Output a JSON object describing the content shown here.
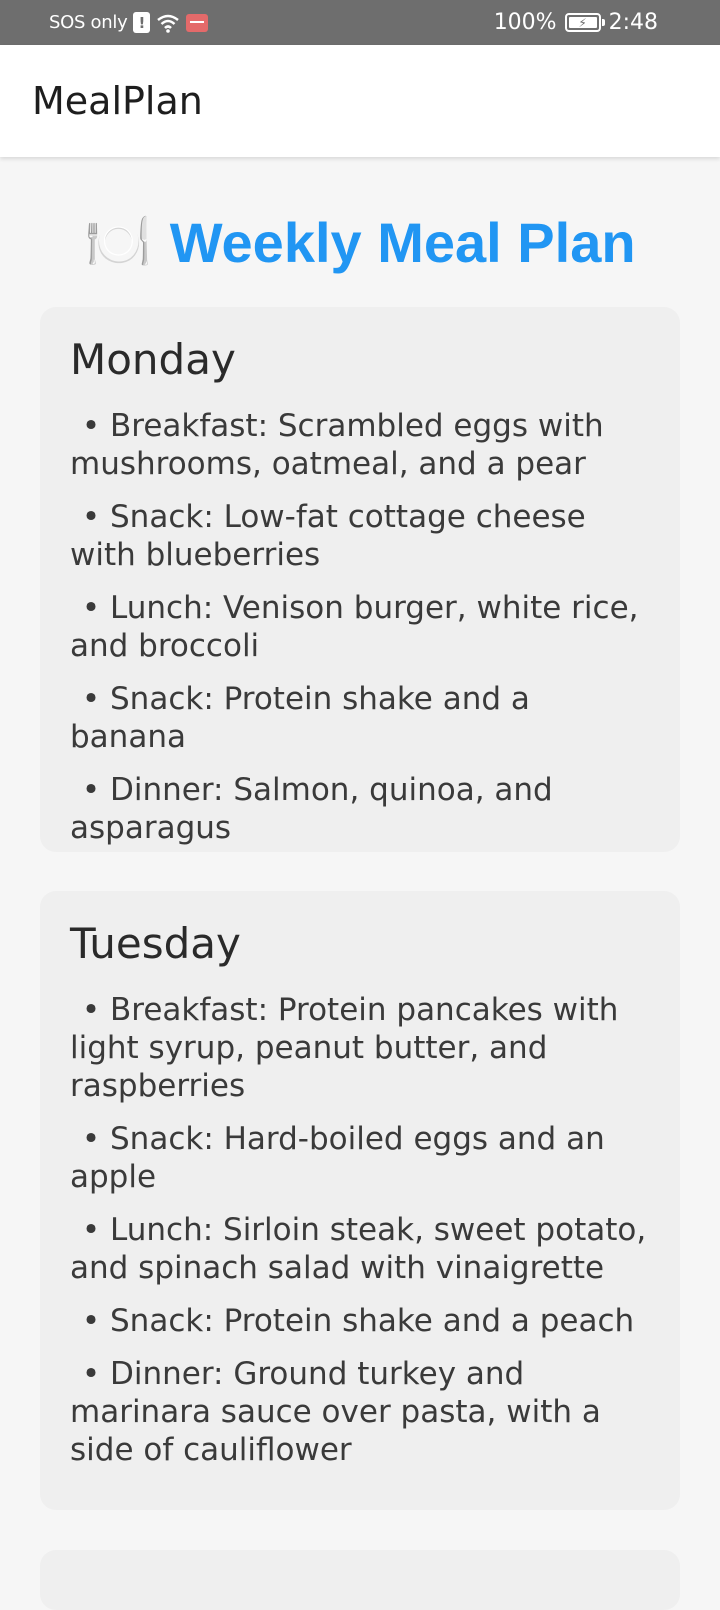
{
  "status_bar": {
    "left_text": "SOS only",
    "battery": "100%",
    "time": "2:48"
  },
  "app_bar": {
    "title": "MealPlan"
  },
  "page": {
    "title_icon": "🍽️",
    "title": "Weekly Meal Plan"
  },
  "days": [
    {
      "name": "Monday",
      "meals": [
        "Breakfast: Scrambled eggs with mushrooms, oatmeal, and a pear",
        "Snack: Low-fat cottage cheese with blueberries",
        "Lunch: Venison burger, white rice, and broccoli",
        "Snack: Protein shake and a banana",
        "Dinner: Salmon, quinoa, and asparagus"
      ]
    },
    {
      "name": "Tuesday",
      "meals": [
        "Breakfast: Protein pancakes with light syrup, peanut butter, and raspberries",
        "Snack: Hard-boiled eggs and an apple",
        "Lunch: Sirloin steak, sweet potato, and spinach salad with vinaigrette",
        "Snack: Protein shake and a peach",
        "Dinner: Ground turkey and marinara sauce over pasta, with a side of cauliflower"
      ]
    }
  ],
  "bullet_char": "•",
  "colors": {
    "accent": "#2196f3",
    "status_bar": "#6e6e6e",
    "card": "#efefef"
  }
}
